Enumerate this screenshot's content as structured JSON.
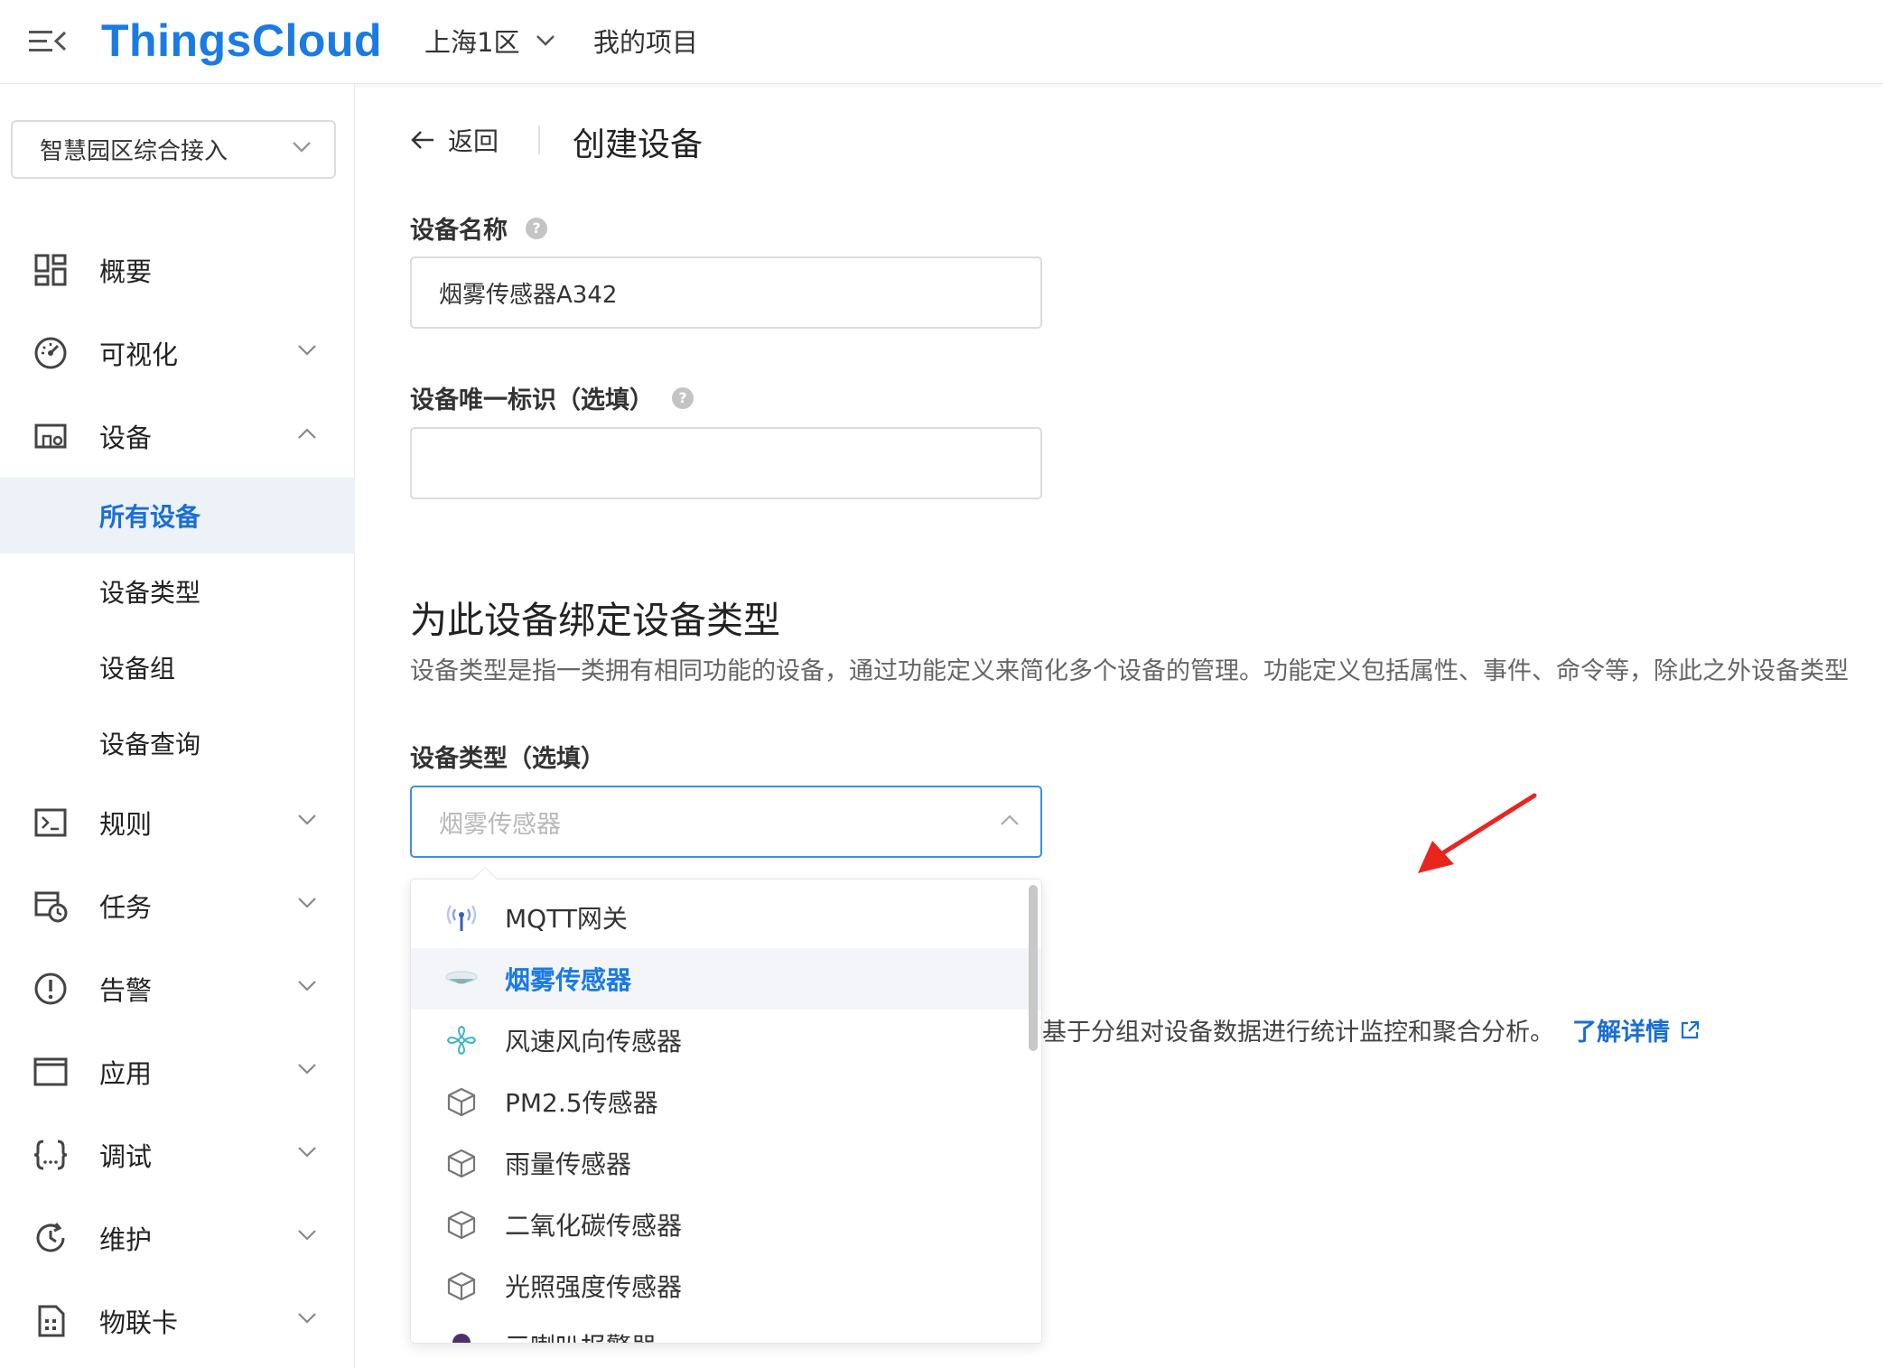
{
  "header": {
    "logo": "ThingsCloud",
    "region": "上海1区",
    "project_link": "我的项目"
  },
  "sidebar": {
    "project_select": "智慧园区综合接入",
    "items": [
      {
        "label": "概要",
        "icon": "dashboard-icon"
      },
      {
        "label": "可视化",
        "icon": "gauge-icon"
      },
      {
        "label": "设备",
        "icon": "devices-icon"
      },
      {
        "label": "规则",
        "icon": "terminal-icon"
      },
      {
        "label": "任务",
        "icon": "schedule-icon"
      },
      {
        "label": "告警",
        "icon": "alert-icon"
      },
      {
        "label": "应用",
        "icon": "window-icon"
      },
      {
        "label": "调试",
        "icon": "braces-icon"
      },
      {
        "label": "维护",
        "icon": "history-icon"
      },
      {
        "label": "物联卡",
        "icon": "sim-card-icon"
      }
    ],
    "device_sub": [
      "所有设备",
      "设备类型",
      "设备组",
      "设备查询"
    ]
  },
  "main": {
    "back_label": "返回",
    "title": "创建设备",
    "name_label": "设备名称",
    "name_value": "烟雾传感器A342",
    "uid_label": "设备唯一标识（选填）",
    "uid_value": "",
    "section_title": "为此设备绑定设备类型",
    "section_desc": "设备类型是指一类拥有相同功能的设备，通过功能定义来简化多个设备的管理。功能定义包括属性、事件、命令等，除此之外设备类型",
    "type_label": "设备类型（选填）",
    "type_value": "烟雾传感器",
    "under_text": "基于分组对设备数据进行统计监控和聚合分析。",
    "learn_more": "了解详情"
  },
  "dropdown": {
    "options": [
      {
        "label": "MQTT网关",
        "icon": "antenna-icon"
      },
      {
        "label": "烟雾传感器",
        "icon": "smoke-detector-icon",
        "selected": true
      },
      {
        "label": "风速风向传感器",
        "icon": "fan-icon"
      },
      {
        "label": "PM2.5传感器",
        "icon": "cube-icon"
      },
      {
        "label": "雨量传感器",
        "icon": "cube-icon"
      },
      {
        "label": "二氧化碳传感器",
        "icon": "cube-icon"
      },
      {
        "label": "光照强度传感器",
        "icon": "cube-icon"
      },
      {
        "label": "三喇叭报警器",
        "icon": "speaker-icon"
      }
    ]
  },
  "colors": {
    "brand": "#1a7ae6",
    "active_bg": "#edf1f8",
    "annotation_arrow": "#e8261e"
  }
}
